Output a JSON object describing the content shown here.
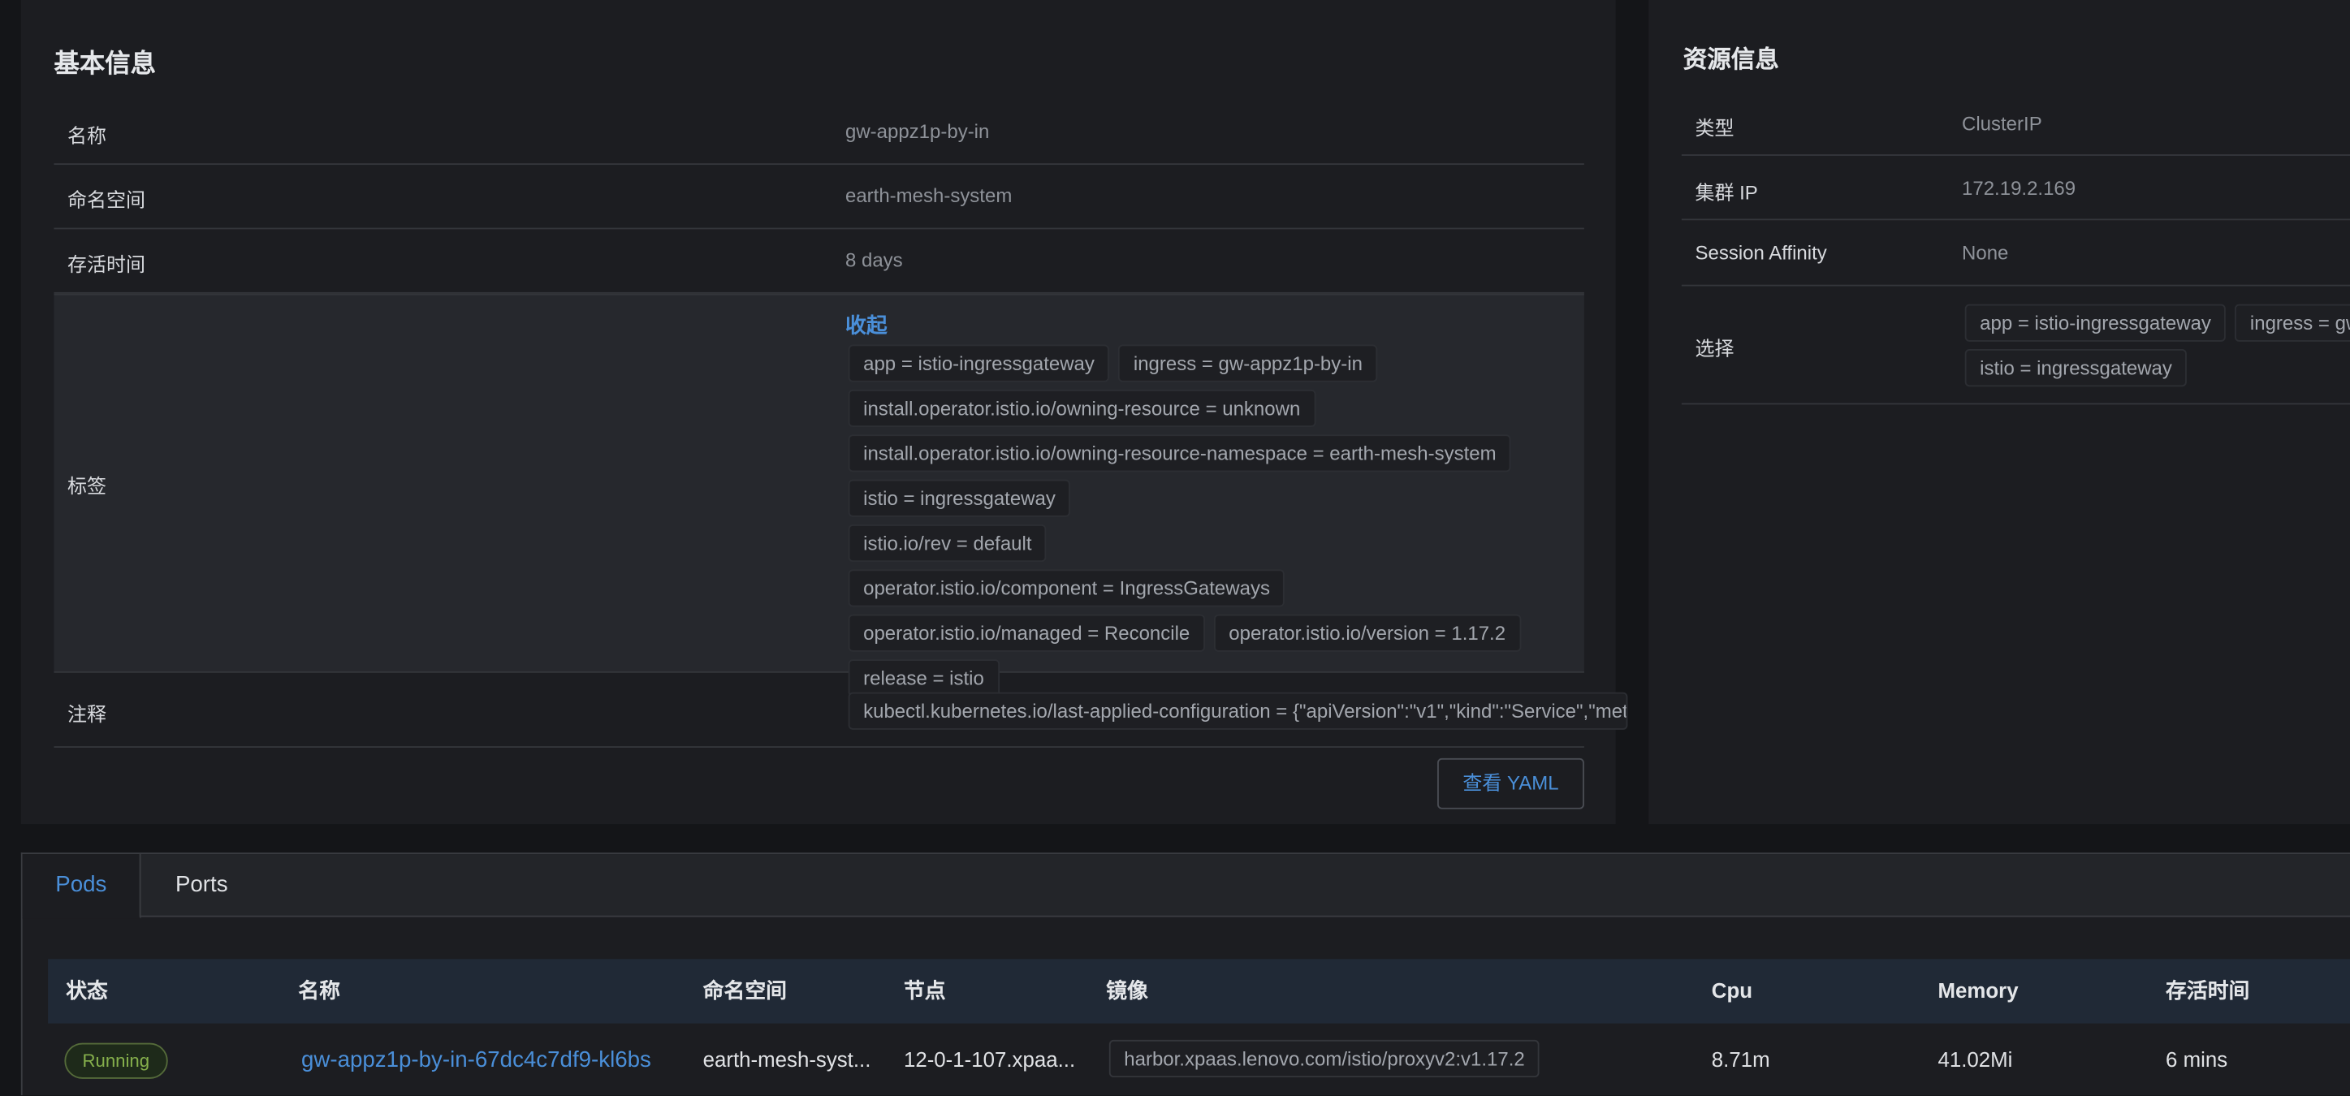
{
  "basic": {
    "title": "基本信息",
    "rows": [
      {
        "key": "名称",
        "value": "gw-appz1p-by-in"
      },
      {
        "key": "命名空间",
        "value": "earth-mesh-system"
      },
      {
        "key": "存活时间",
        "value": "8 days"
      }
    ],
    "labels_key": "标签",
    "collapse_label": "收起",
    "labels": [
      "app = istio-ingressgateway",
      "ingress = gw-appz1p-by-in",
      "install.operator.istio.io/owning-resource = unknown",
      "install.operator.istio.io/owning-resource-namespace = earth-mesh-system",
      "istio = ingressgateway",
      "istio.io/rev = default",
      "operator.istio.io/component = IngressGateways",
      "operator.istio.io/managed = Reconcile",
      "operator.istio.io/version = 1.17.2",
      "release = istio"
    ],
    "annotations_key": "注释",
    "annotation": "kubectl.kubernetes.io/last-applied-configuration = {\"apiVersion\":\"v1\",\"kind\":\"Service\",\"met",
    "yaml_button": "查看 YAML"
  },
  "resource": {
    "title": "资源信息",
    "rows": [
      {
        "key": "类型",
        "value": "ClusterIP"
      },
      {
        "key": "集群 IP",
        "value": "172.19.2.169"
      },
      {
        "key": "Session Affinity",
        "value": "None"
      }
    ],
    "selector_key": "选择",
    "selectors": [
      "app = istio-ingressgateway",
      "ingress = gw",
      "istio = ingressgateway"
    ]
  },
  "tabs": [
    {
      "label": "Pods",
      "active": true
    },
    {
      "label": "Ports",
      "active": false
    }
  ],
  "pods_table": {
    "headers": [
      "状态",
      "名称",
      "命名空间",
      "节点",
      "镜像",
      "Cpu",
      "Memory",
      "存活时间"
    ],
    "rows": [
      {
        "status": "Running",
        "name": "gw-appz1p-by-in-67dc4c7df9-kl6bs",
        "namespace": "earth-mesh-syst...",
        "node": "12-0-1-107.xpaa...",
        "image": "harbor.xpaas.lenovo.com/istio/proxyv2:v1.17.2",
        "cpu": "8.71m",
        "memory": "41.02Mi",
        "age": "6 mins"
      }
    ]
  },
  "colors": {
    "accent": "#4a8fd9",
    "running": "#86b04c",
    "panel": "#1c1d21",
    "background": "#141518"
  }
}
